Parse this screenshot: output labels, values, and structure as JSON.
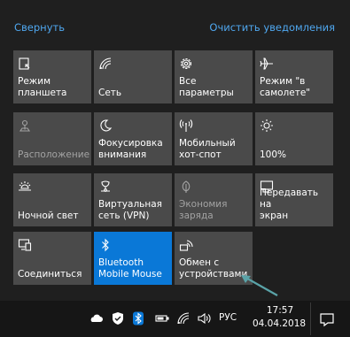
{
  "header": {
    "collapse_label": "Свернуть",
    "clear_label": "Очистить уведомления"
  },
  "tiles": [
    {
      "label": "Режим\nпланшета",
      "icon": "tablet-mode-icon",
      "state": "off"
    },
    {
      "label": "Сеть",
      "icon": "network-icon",
      "state": "off"
    },
    {
      "label": "Все параметры",
      "icon": "gear-icon",
      "state": "off"
    },
    {
      "label": "Режим \"в\nсамолете\"",
      "icon": "airplane-icon",
      "state": "off"
    },
    {
      "label": "Расположение",
      "icon": "location-icon",
      "state": "disabled"
    },
    {
      "label": "Фокусировка\nвнимания",
      "icon": "moon-icon",
      "state": "off"
    },
    {
      "label": "Мобильный\nхот-спот",
      "icon": "hotspot-icon",
      "state": "off"
    },
    {
      "label": "100%",
      "icon": "brightness-icon",
      "state": "off"
    },
    {
      "label": "Ночной свет",
      "icon": "night-light-icon",
      "state": "off"
    },
    {
      "label": "Виртуальная\nсеть (VPN)",
      "icon": "vpn-icon",
      "state": "off"
    },
    {
      "label": "Экономия\nзаряда",
      "icon": "battery-saver-icon",
      "state": "disabled"
    },
    {
      "label": "Передавать на\nэкран",
      "icon": "project-icon",
      "state": "off"
    },
    {
      "label": "Соединиться",
      "icon": "connect-icon",
      "state": "off"
    },
    {
      "label": "Bluetooth\nMobile Mouse",
      "icon": "bluetooth-icon",
      "state": "on"
    },
    {
      "label": "Обмен с\nустройствами",
      "icon": "nearby-sharing-icon",
      "state": "off"
    }
  ],
  "taskbar": {
    "language": "РУС",
    "time": "17:57",
    "date": "04.04.2018"
  },
  "colors": {
    "accent": "#0a78d7",
    "link": "#4fa7ef",
    "tile": "#4a4a4a",
    "panel": "#1f1f1f",
    "pointer": "#5aa3a8"
  }
}
